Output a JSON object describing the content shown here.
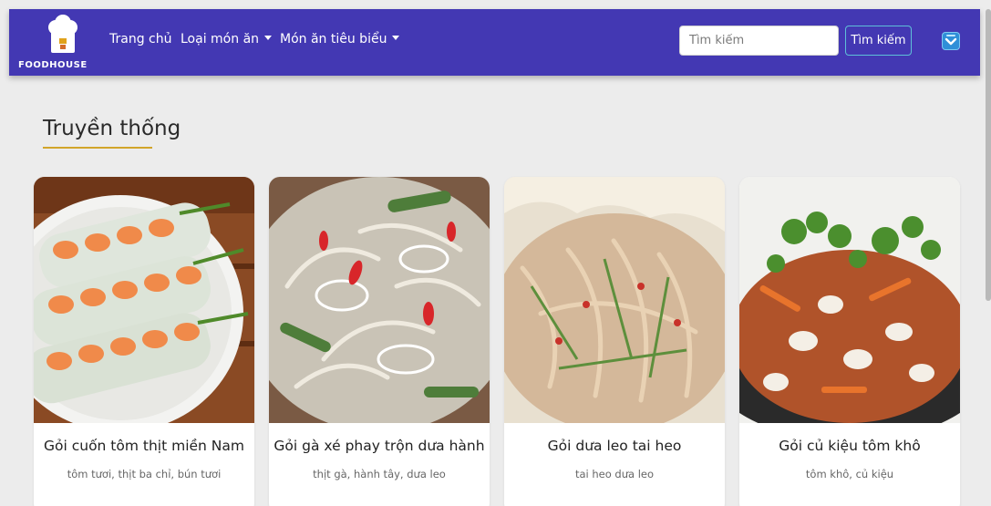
{
  "brand": {
    "name": "FOODHOUSE"
  },
  "nav": {
    "home": "Trang chủ",
    "categories": "Loại món ăn",
    "featured": "Món ăn tiêu biểu"
  },
  "search": {
    "placeholder": "Tìm kiếm",
    "button": "Tìm kiếm"
  },
  "icons": {
    "logo": "chef-hat-icon",
    "dropdown": "caret-down-icon",
    "user": "user-dropdown-icon"
  },
  "colors": {
    "navbar": "#4338b3",
    "underline": "#d2a52a",
    "background": "#ececec"
  },
  "section": {
    "title": "Truyền thống",
    "cards": [
      {
        "name": "Gỏi cuốn tôm thịt miền Nam",
        "desc": "tôm tươi, thịt ba chỉ, bún tươi"
      },
      {
        "name": "Gỏi gà xé phay trộn dưa hành",
        "desc": "thịt gà, hành tây, dưa leo"
      },
      {
        "name": "Gỏi dưa leo tai heo",
        "desc": "tai heo dưa leo"
      },
      {
        "name": "Gỏi củ kiệu tôm khô",
        "desc": "tôm khô, củ kiệu"
      }
    ]
  }
}
